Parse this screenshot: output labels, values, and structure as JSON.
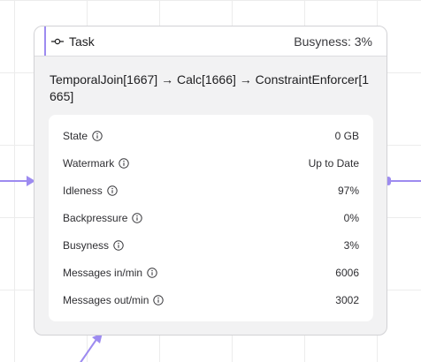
{
  "node": {
    "type_label": "Task",
    "busyness_header": "Busyness: 3%",
    "title": "TemporalJoin[1667] → Calc[1666] → ConstraintEnforcer[1665]",
    "metrics": [
      {
        "label": "State",
        "value": "0 GB"
      },
      {
        "label": "Watermark",
        "value": "Up to Date"
      },
      {
        "label": "Idleness",
        "value": "97%"
      },
      {
        "label": "Backpressure",
        "value": "0%"
      },
      {
        "label": "Busyness",
        "value": "3%"
      },
      {
        "label": "Messages in/min",
        "value": "6006"
      },
      {
        "label": "Messages out/min",
        "value": "3002"
      }
    ]
  },
  "icons": {
    "task": "commit-node-icon",
    "info": "info-circle-icon"
  },
  "colors": {
    "edge": "#9d8bf0",
    "node_background": "#f2f2f3",
    "header_background": "#ffffff",
    "metrics_background": "#ffffff"
  }
}
